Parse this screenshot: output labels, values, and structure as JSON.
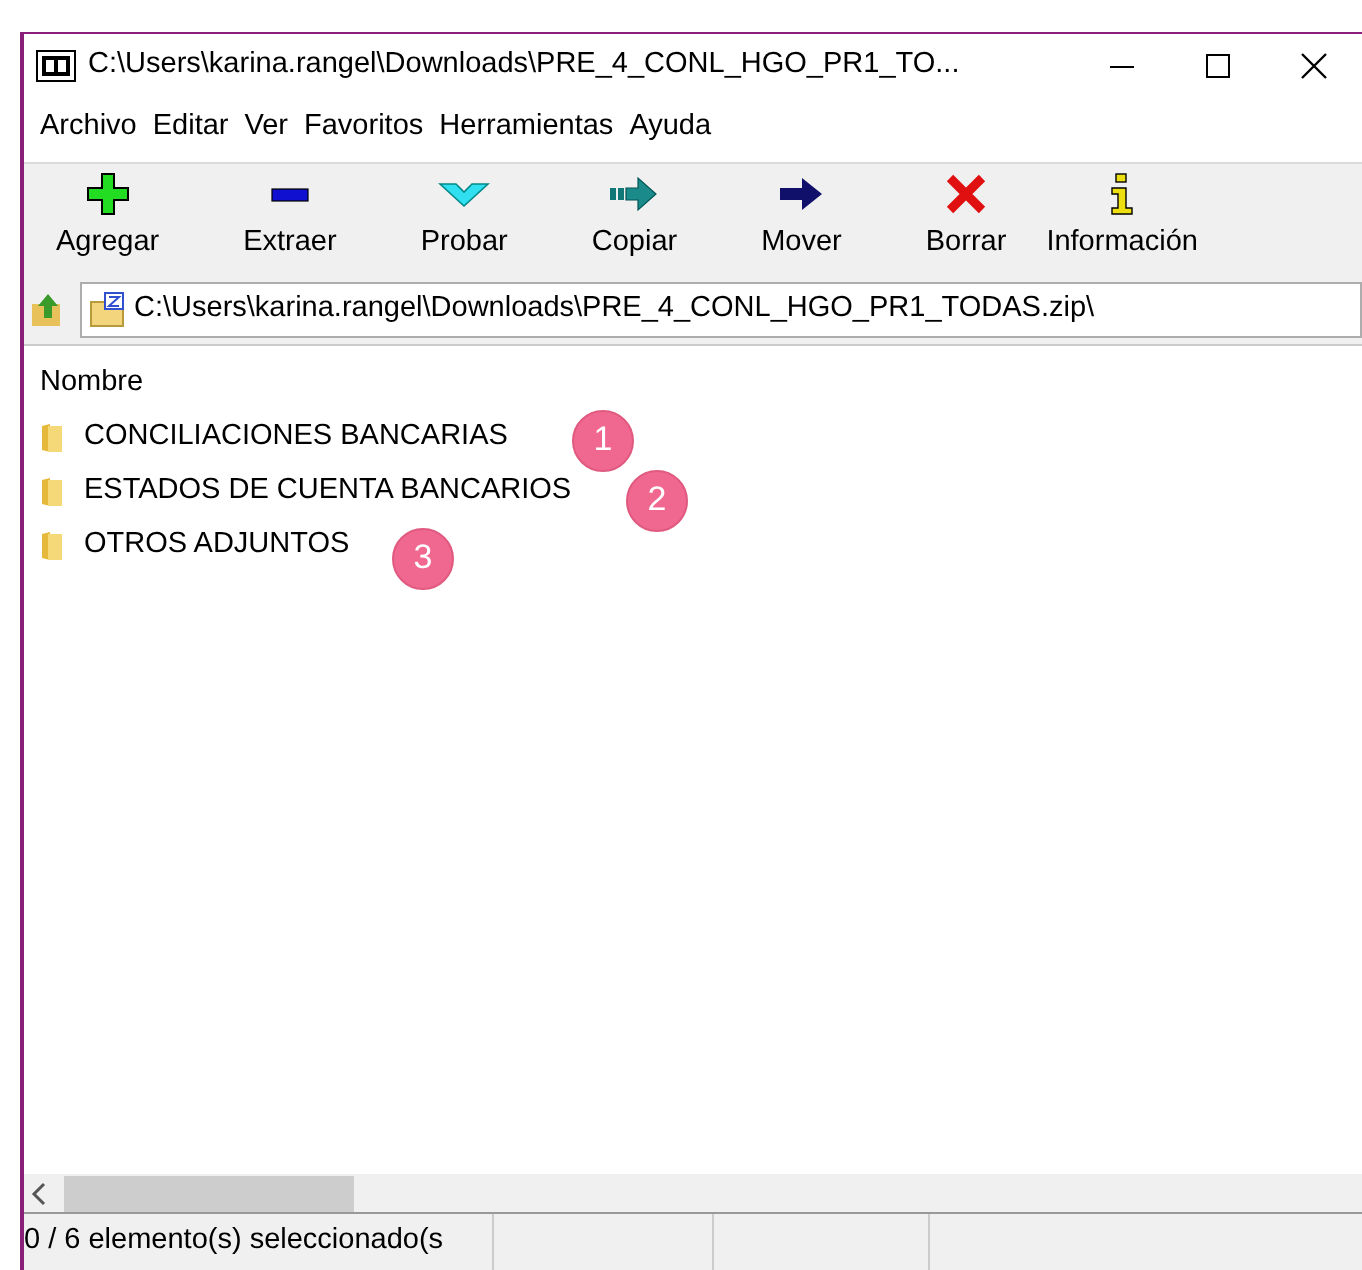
{
  "window": {
    "title": "C:\\Users\\karina.rangel\\Downloads\\PRE_4_CONL_HGO_PR1_TO..."
  },
  "menu": [
    "Archivo",
    "Editar",
    "Ver",
    "Favoritos",
    "Herramientas",
    "Ayuda"
  ],
  "toolbar": [
    {
      "kind": "add",
      "label": "Agregar"
    },
    {
      "kind": "extract",
      "label": "Extraer"
    },
    {
      "kind": "test",
      "label": "Probar"
    },
    {
      "kind": "copy",
      "label": "Copiar"
    },
    {
      "kind": "move",
      "label": "Mover"
    },
    {
      "kind": "delete",
      "label": "Borrar"
    },
    {
      "kind": "info",
      "label": "Información"
    }
  ],
  "address": {
    "value": "C:\\Users\\karina.rangel\\Downloads\\PRE_4_CONL_HGO_PR1_TODAS.zip\\"
  },
  "list": {
    "columns": [
      "Nombre"
    ],
    "rows": [
      {
        "name": "CONCILIACIONES BANCARIAS"
      },
      {
        "name": "ESTADOS DE CUENTA BANCARIOS"
      },
      {
        "name": "OTROS ADJUNTOS"
      }
    ]
  },
  "markers": [
    {
      "label": "1"
    },
    {
      "label": "2"
    },
    {
      "label": "3"
    }
  ],
  "status_bar": "0 / 6 elemento(s) seleccionado(s"
}
